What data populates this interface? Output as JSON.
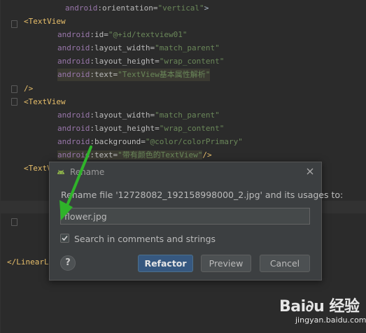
{
  "code": {
    "line1": {
      "ns": "android",
      "attr": ":orientation=",
      "val": "\"vertical\"",
      "end": ">"
    },
    "line2": {
      "tag": "<TextView"
    },
    "line3": {
      "ns": "android",
      "attr": ":id=",
      "val": "\"@+id/textview01\""
    },
    "line4": {
      "ns": "android",
      "attr": ":layout_width=",
      "val": "\"match_parent\""
    },
    "line5": {
      "ns": "android",
      "attr": ":layout_height=",
      "val": "\"wrap_content\""
    },
    "line6": {
      "ns": "android",
      "attr": ":text=",
      "val": "\"TextView基本属性解析\""
    },
    "line7": {
      "tag": "/>"
    },
    "line8": {
      "tag": "<TextView"
    },
    "line9": {
      "ns": "android",
      "attr": ":layout_width=",
      "val": "\"match_parent\""
    },
    "line10": {
      "ns": "android",
      "attr": ":layout_height=",
      "val": "\"wrap_content\""
    },
    "line11": {
      "ns": "android",
      "attr": ":background=",
      "val": "\"@color/colorPrimary\""
    },
    "line12": {
      "ns": "android",
      "attr": ":text=",
      "val": "\"带有颜色的TextView\"",
      "end": "/>"
    },
    "line13": {
      "tag": "<TextVi"
    },
    "line14": {
      "tag": "</LinearLa"
    }
  },
  "dialog": {
    "title": "Rename",
    "message": "Rename file '12728082_192158998000_2.jpg' and its usages to:",
    "input_value": "flower.jpg",
    "checkbox_label": "Search in comments and strings",
    "checkbox_checked": true,
    "help_label": "?",
    "refactor_label": "Refactor",
    "preview_label": "Preview",
    "cancel_label": "Cancel"
  },
  "watermark": {
    "brand": "Bai∂u 经验",
    "site": "jingyan.baidu.com"
  },
  "colors": {
    "editor_bg": "#2b2b2b",
    "dialog_bg": "#3c3f41",
    "accent_button": "#365880",
    "arrow": "#2fb32a"
  }
}
